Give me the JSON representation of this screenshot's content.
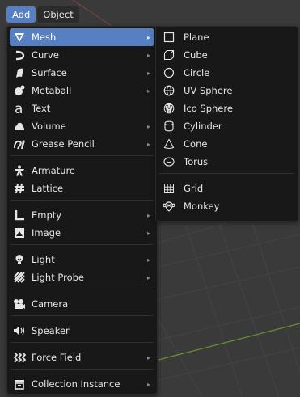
{
  "topbar": {
    "add": "Add",
    "object": "Object"
  },
  "menu": {
    "items": [
      {
        "label": "Mesh",
        "submenu": true,
        "active": true,
        "icon": "mesh-icon"
      },
      {
        "label": "Curve",
        "submenu": true,
        "icon": "curve-icon"
      },
      {
        "label": "Surface",
        "submenu": true,
        "icon": "surface-icon"
      },
      {
        "label": "Metaball",
        "submenu": true,
        "icon": "metaball-icon"
      },
      {
        "label": "Text",
        "submenu": false,
        "icon": "text-icon"
      },
      {
        "label": "Volume",
        "submenu": true,
        "icon": "volume-icon"
      },
      {
        "label": "Grease Pencil",
        "submenu": true,
        "icon": "grease-pencil-icon"
      },
      {
        "label": "Armature",
        "submenu": false,
        "icon": "armature-icon"
      },
      {
        "label": "Lattice",
        "submenu": false,
        "icon": "lattice-icon"
      },
      {
        "label": "Empty",
        "submenu": true,
        "icon": "empty-icon"
      },
      {
        "label": "Image",
        "submenu": true,
        "icon": "image-icon"
      },
      {
        "label": "Light",
        "submenu": true,
        "icon": "light-icon"
      },
      {
        "label": "Light Probe",
        "submenu": true,
        "icon": "light-probe-icon"
      },
      {
        "label": "Camera",
        "submenu": false,
        "icon": "camera-icon"
      },
      {
        "label": "Speaker",
        "submenu": false,
        "icon": "speaker-icon"
      },
      {
        "label": "Force Field",
        "submenu": true,
        "icon": "force-field-icon"
      },
      {
        "label": "Collection Instance",
        "submenu": true,
        "icon": "collection-instance-icon"
      }
    ]
  },
  "mesh_submenu": {
    "items": [
      {
        "label": "Plane",
        "icon": "plane-icon"
      },
      {
        "label": "Cube",
        "icon": "cube-icon"
      },
      {
        "label": "Circle",
        "icon": "circle-icon"
      },
      {
        "label": "UV Sphere",
        "icon": "uv-sphere-icon"
      },
      {
        "label": "Ico Sphere",
        "icon": "ico-sphere-icon"
      },
      {
        "label": "Cylinder",
        "icon": "cylinder-icon"
      },
      {
        "label": "Cone",
        "icon": "cone-icon"
      },
      {
        "label": "Torus",
        "icon": "torus-icon"
      },
      {
        "label": "Grid",
        "icon": "grid-icon"
      },
      {
        "label": "Monkey",
        "icon": "monkey-icon"
      }
    ]
  },
  "colors": {
    "accent": "#5680c2",
    "menu_bg": "#181818",
    "viewport_bg": "#3a3a3a",
    "x_axis": "#8b4040",
    "y_axis": "#6a8f2e"
  }
}
